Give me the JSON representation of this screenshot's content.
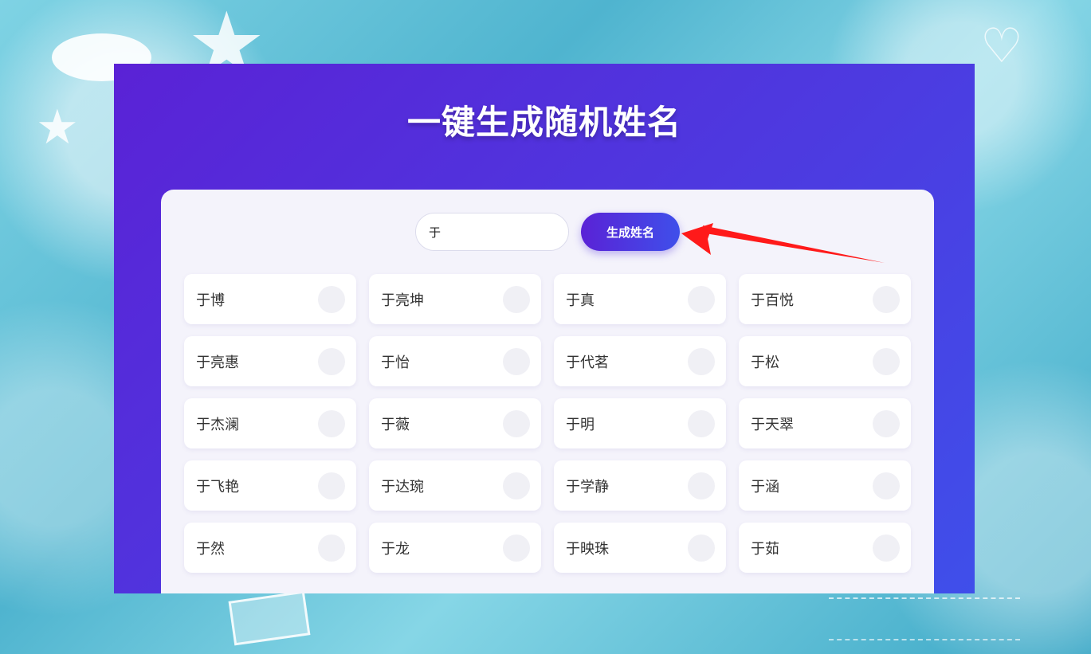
{
  "page": {
    "title": "一键生成随机姓名"
  },
  "controls": {
    "surname_value": "于",
    "generate_label": "生成姓名"
  },
  "names": [
    "于博",
    "于亮坤",
    "于真",
    "于百悦",
    "于亮惠",
    "于怡",
    "于代茗",
    "于松",
    "于杰澜",
    "于薇",
    "于明",
    "于天翠",
    "于飞艳",
    "于达琬",
    "于学静",
    "于涵",
    "于然",
    "于龙",
    "于映珠",
    "于茹"
  ],
  "colors": {
    "header_gradient_start": "#5a22d6",
    "header_gradient_end": "#3f4fea",
    "panel_bg": "#f4f3fb",
    "annotation_arrow": "#ff1a1a"
  },
  "icons": {
    "card_action": "copy-icon",
    "annotation": "red-arrow-icon"
  }
}
